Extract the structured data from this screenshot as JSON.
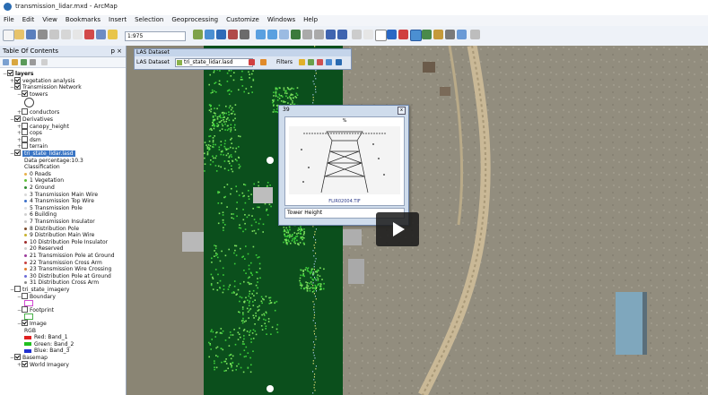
{
  "window": {
    "title": "transmission_lidar.mxd - ArcMap"
  },
  "menu": [
    "File",
    "Edit",
    "View",
    "Bookmarks",
    "Insert",
    "Selection",
    "Geoprocessing",
    "Customize",
    "Windows",
    "Help"
  ],
  "toolbar": {
    "scale": "1:975"
  },
  "toc": {
    "title": "Table Of Contents",
    "pin": "p ×",
    "items": [
      {
        "label": "layers",
        "checked": true,
        "indent": 0,
        "expand": "−",
        "bold": true
      },
      {
        "label": "vegetation analysis",
        "checked": true,
        "indent": 1,
        "expand": "+"
      },
      {
        "label": "Transmission Network",
        "checked": true,
        "indent": 1,
        "expand": "−"
      },
      {
        "label": "towers",
        "checked": true,
        "indent": 2,
        "expand": "−"
      },
      {
        "label": "",
        "indent": 3,
        "symbol": "circle"
      },
      {
        "label": "conductors",
        "checked": false,
        "indent": 2,
        "expand": "+"
      },
      {
        "label": "Derivatives",
        "checked": true,
        "indent": 1,
        "expand": "−"
      },
      {
        "label": "canopy_height",
        "checked": false,
        "indent": 2,
        "expand": "+"
      },
      {
        "label": "cops",
        "checked": false,
        "indent": 2,
        "expand": "+"
      },
      {
        "label": "dsm",
        "checked": false,
        "indent": 2,
        "expand": "+"
      },
      {
        "label": "terrain",
        "checked": false,
        "indent": 2,
        "expand": "+"
      },
      {
        "label": "tri_state_lidar.lasd",
        "checked": true,
        "indent": 1,
        "expand": "−",
        "selected": true
      },
      {
        "label": "Data percentage:10.3",
        "indent": 3
      },
      {
        "label": "Classification",
        "indent": 3
      },
      {
        "label": "0 Roads",
        "indent": 3,
        "dot": "#e8b04a"
      },
      {
        "label": "1 Vegetation",
        "indent": 3,
        "dot": "#5fbf3a"
      },
      {
        "label": "2 Ground",
        "indent": 3,
        "dot": "#2f8a2f"
      },
      {
        "label": "3 Transmission Main Wire",
        "indent": 3,
        "dot": "#d9d9d9"
      },
      {
        "label": "4 Transmission Top Wire",
        "indent": 3,
        "dot": "#3b6fc9"
      },
      {
        "label": "5 Transmission Pole",
        "indent": 3,
        "dot": "#e0e0e0"
      },
      {
        "label": "6 Building",
        "indent": 3,
        "dot": "#d0d0d0"
      },
      {
        "label": "7 Transmission Insulator",
        "indent": 3,
        "dot": "#c8c8c8"
      },
      {
        "label": "8 Distribution Pole",
        "indent": 3,
        "dot": "#7a4a2a"
      },
      {
        "label": "9 Distribution Main Wire",
        "indent": 3,
        "dot": "#c7b22f"
      },
      {
        "label": "10 Distribution Pole Insulator",
        "indent": 3,
        "dot": "#9e2b2b"
      },
      {
        "label": "20 Reserved",
        "indent": 3,
        "dot": "#cfcfcf"
      },
      {
        "label": "21 Transmission Pole at Ground",
        "indent": 3,
        "dot": "#9b3b9b"
      },
      {
        "label": "22 Transmission Cross Arm",
        "indent": 3,
        "dot": "#c94040"
      },
      {
        "label": "23 Transmission Wire Crossing",
        "indent": 3,
        "dot": "#e07b2b"
      },
      {
        "label": "30 Distribution Pole at Ground",
        "indent": 3,
        "dot": "#6b6bd6"
      },
      {
        "label": "31 Distribution Cross Arm",
        "indent": 3,
        "dot": "#8a8a8a"
      },
      {
        "label": "tri_state_imagery",
        "checked": false,
        "indent": 1,
        "expand": "−"
      },
      {
        "label": "Boundary",
        "checked": false,
        "indent": 2,
        "expand": "−"
      },
      {
        "label": "",
        "indent": 3,
        "swatch": "#ffffff",
        "border": "#d04ad0"
      },
      {
        "label": "Footprint",
        "checked": false,
        "indent": 2,
        "expand": "−"
      },
      {
        "label": "",
        "indent": 3,
        "swatch": "#ffffff",
        "border": "#4ab04a"
      },
      {
        "label": "Image",
        "checked": true,
        "indent": 2,
        "expand": "−"
      },
      {
        "label": "RGB",
        "indent": 3
      },
      {
        "label": "Red:   Band_1",
        "indent": 3,
        "swatch": "#e02020"
      },
      {
        "label": "Green: Band_2",
        "indent": 3,
        "swatch": "#20c020"
      },
      {
        "label": "Blue:  Band_3",
        "indent": 3,
        "swatch": "#2030d0"
      },
      {
        "label": "Basemap",
        "checked": true,
        "indent": 1,
        "expand": "−"
      },
      {
        "label": "World Imagery",
        "checked": true,
        "indent": 2,
        "expand": "+"
      }
    ]
  },
  "las_toolbar": {
    "title": "LAS Dataset",
    "label": "LAS Dataset",
    "dataset": "tri_state_lidar.lasd",
    "filters": "Filters"
  },
  "popup": {
    "title": "39",
    "percent": "%",
    "filename": "FLIR02004.TIF",
    "field": "Tower Height"
  },
  "colors": {
    "lidar_ground": "#0b4f1c",
    "lidar_veg": "#3ccf3a",
    "selection": "#3a75c4"
  }
}
